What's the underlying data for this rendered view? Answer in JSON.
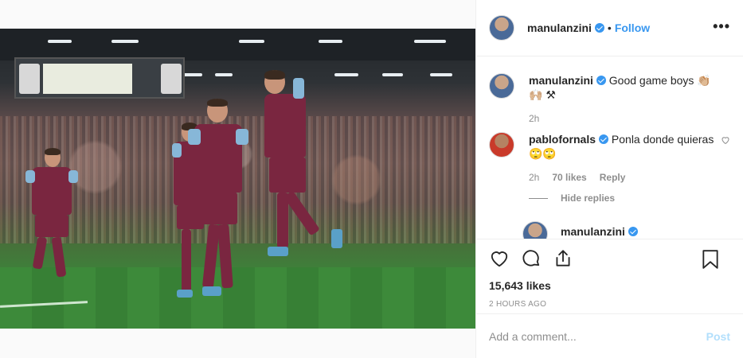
{
  "post": {
    "author": "manulanzini",
    "follow_label": "Follow",
    "dot": "•",
    "more_label": "•••"
  },
  "caption": {
    "username": "manulanzini",
    "text": "Good game boys 👏🏼🙌🏼 ⚒",
    "time": "2h"
  },
  "reply": {
    "username": "pablofornals",
    "text": "Ponla donde quieras 🙄🙄",
    "time": "2h",
    "likes_label": "70 likes",
    "reply_label": "Reply",
    "hide_replies_label": "Hide replies"
  },
  "partial_reply": {
    "username": "manulanzini"
  },
  "actions": {
    "likes": "15,643 likes",
    "timestamp": "2 HOURS AGO"
  },
  "add_comment": {
    "placeholder": "Add a comment...",
    "post_label": "Post"
  },
  "colors": {
    "accent": "#3897f0",
    "post_disabled": "#b2dffc",
    "muted": "#8e8e8e"
  },
  "icons": [
    "heart-icon",
    "comment-icon",
    "share-icon",
    "bookmark-icon",
    "verified-badge-icon",
    "more-options-icon"
  ]
}
